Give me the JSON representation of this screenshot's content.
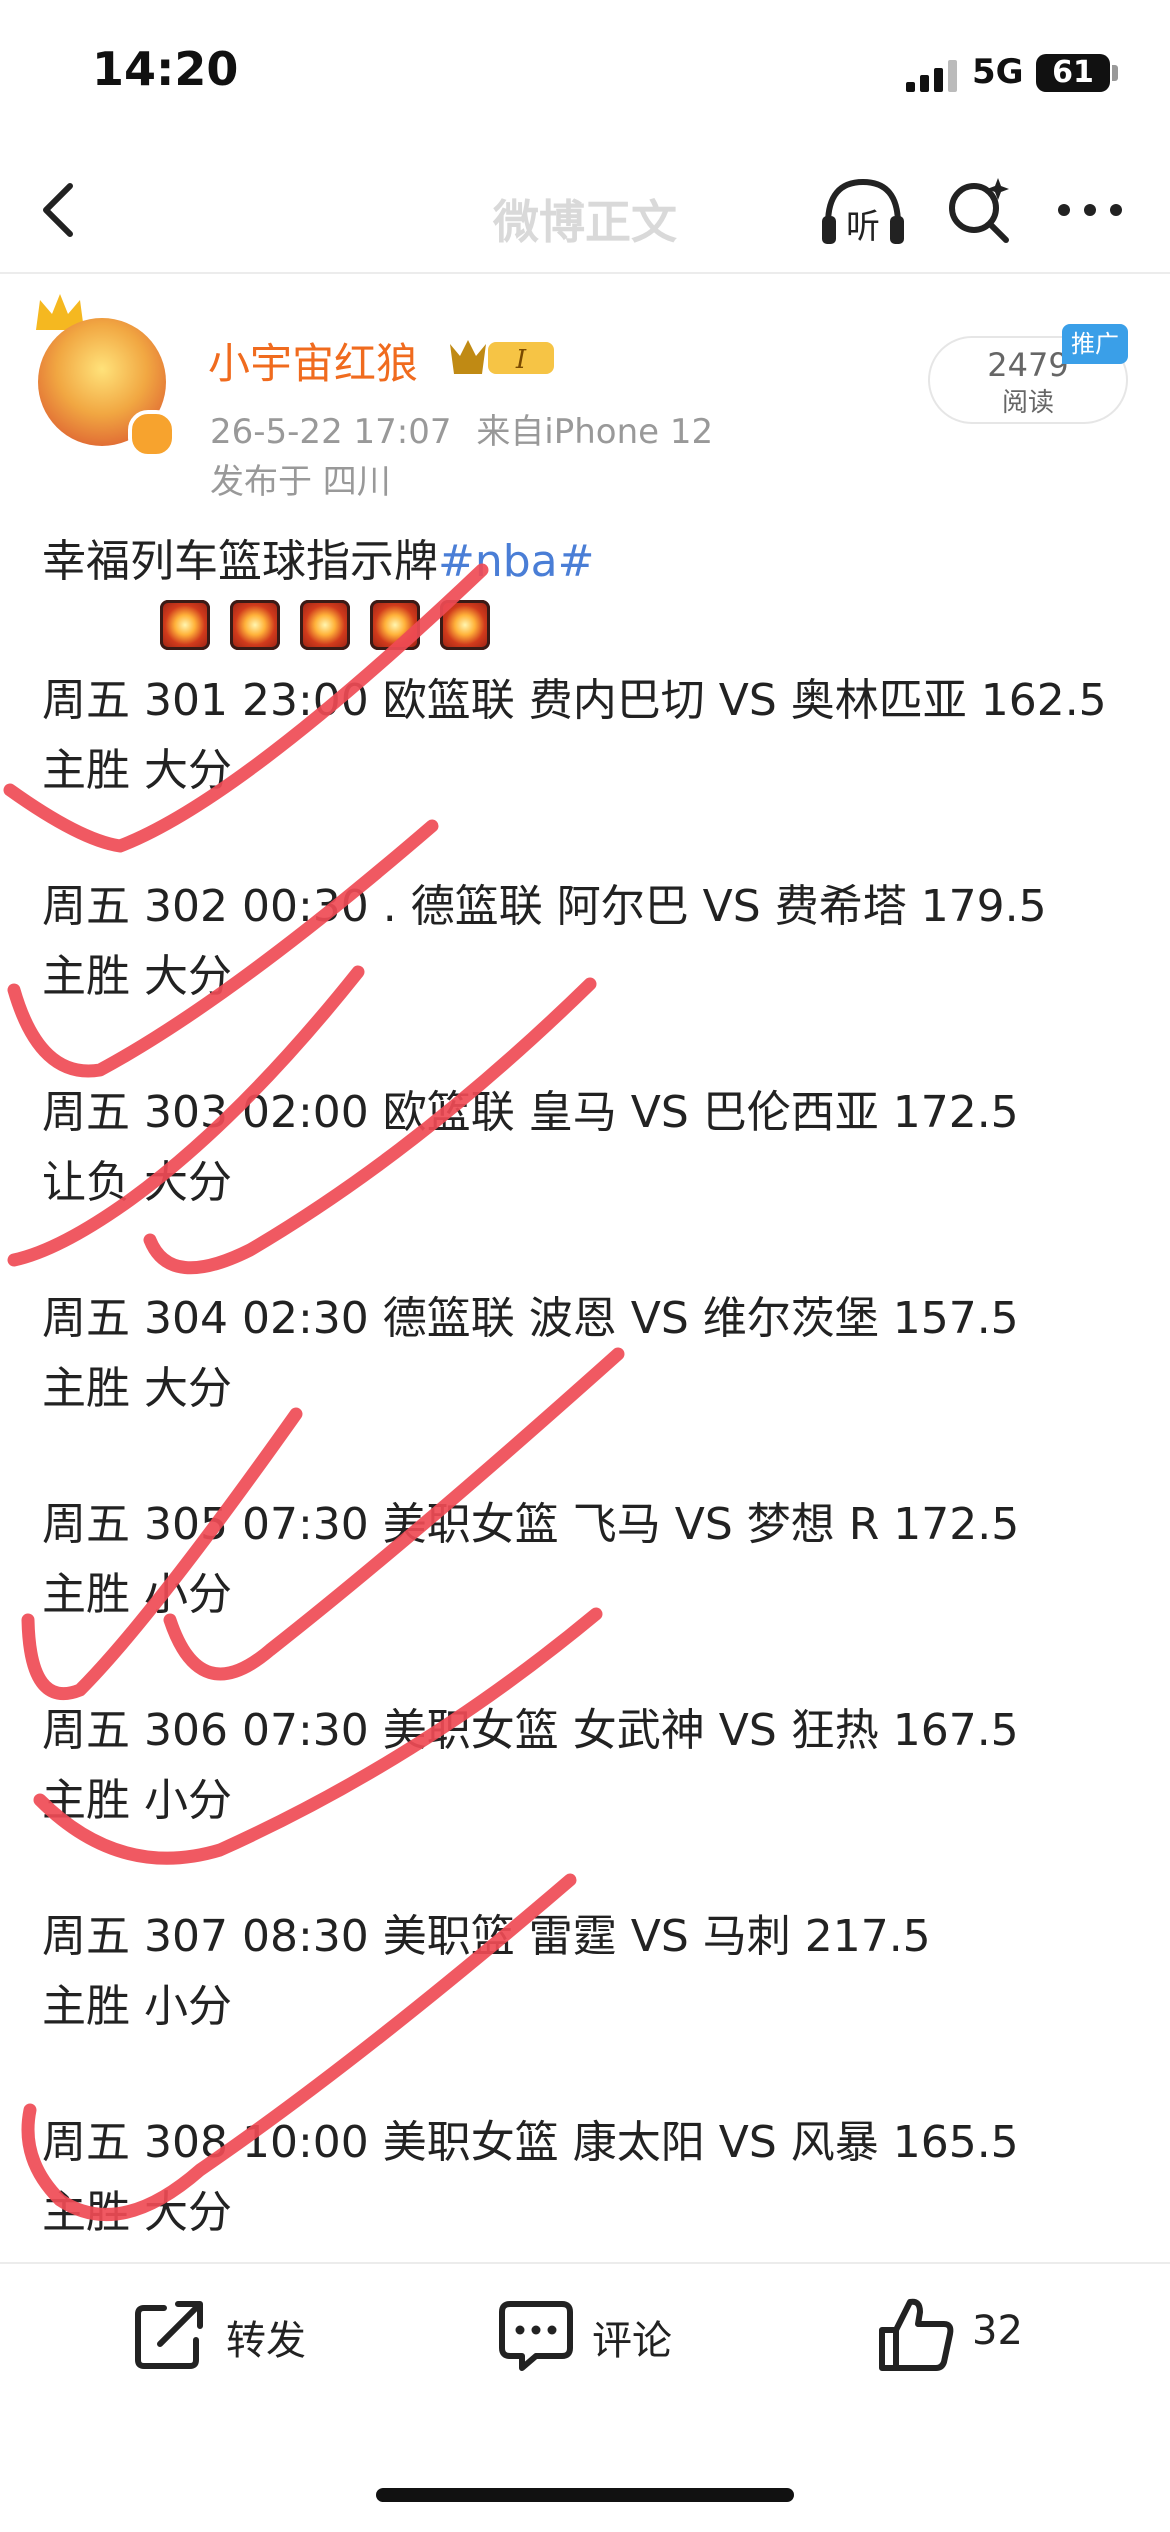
{
  "status_bar": {
    "time": "14:20",
    "network": "5G",
    "battery": "61"
  },
  "nav": {
    "title": "微博正文",
    "listen_label": "听"
  },
  "author": {
    "name": "小宇宙红狼",
    "level": "I",
    "date": "26-5-22 17:07",
    "source": "来自iPhone 12",
    "location": "发布于 四川",
    "reads": "2479",
    "reads_label": "阅读",
    "promo": "推广"
  },
  "post": {
    "intro": "幸福列车篮球指示牌",
    "hashtag": "#nba#",
    "games": [
      {
        "line1": "周五 301 23:00 欧篮联 费内巴切 VS 奥林匹亚 162.5",
        "line2": "主胜 大分"
      },
      {
        "line1": "周五 302 00:30 . 德篮联 阿尔巴 VS 费希塔 179.5",
        "line2": "主胜 大分"
      },
      {
        "line1": "周五 303 02:00 欧篮联 皇马 VS 巴伦西亚 172.5",
        "line2": "让负 大分"
      },
      {
        "line1": "周五 304 02:30 德篮联 波恩 VS 维尔茨堡 157.5",
        "line2": "主胜 大分"
      },
      {
        "line1": "周五 305 07:30 美职女篮 飞马 VS 梦想 R 172.5",
        "line2": "主胜 小分"
      },
      {
        "line1": "周五 306 07:30 美职女篮 女武神 VS 狂热 167.5",
        "line2": "主胜 小分"
      },
      {
        "line1": "周五 307 08:30 美职篮 雷霆 VS 马刺 217.5",
        "line2": "主胜 小分"
      },
      {
        "line1": "周五 308 10:00 美职女篮 康太阳 VS 风暴 165.5",
        "line2": "主胜 大分"
      }
    ]
  },
  "actions": {
    "repost": "转发",
    "comment": "评论",
    "like_count": "32"
  },
  "colors": {
    "author_name": "#f06b1e",
    "hashtag": "#4a7ed6",
    "check_marks": "#ef4b55",
    "promo": "#3a9fe8"
  },
  "icons": [
    "back-chevron-icon",
    "listen-headphone-icon",
    "search-sparkle-icon",
    "more-dots-icon",
    "repost-icon",
    "comment-icon",
    "like-thumb-icon"
  ]
}
